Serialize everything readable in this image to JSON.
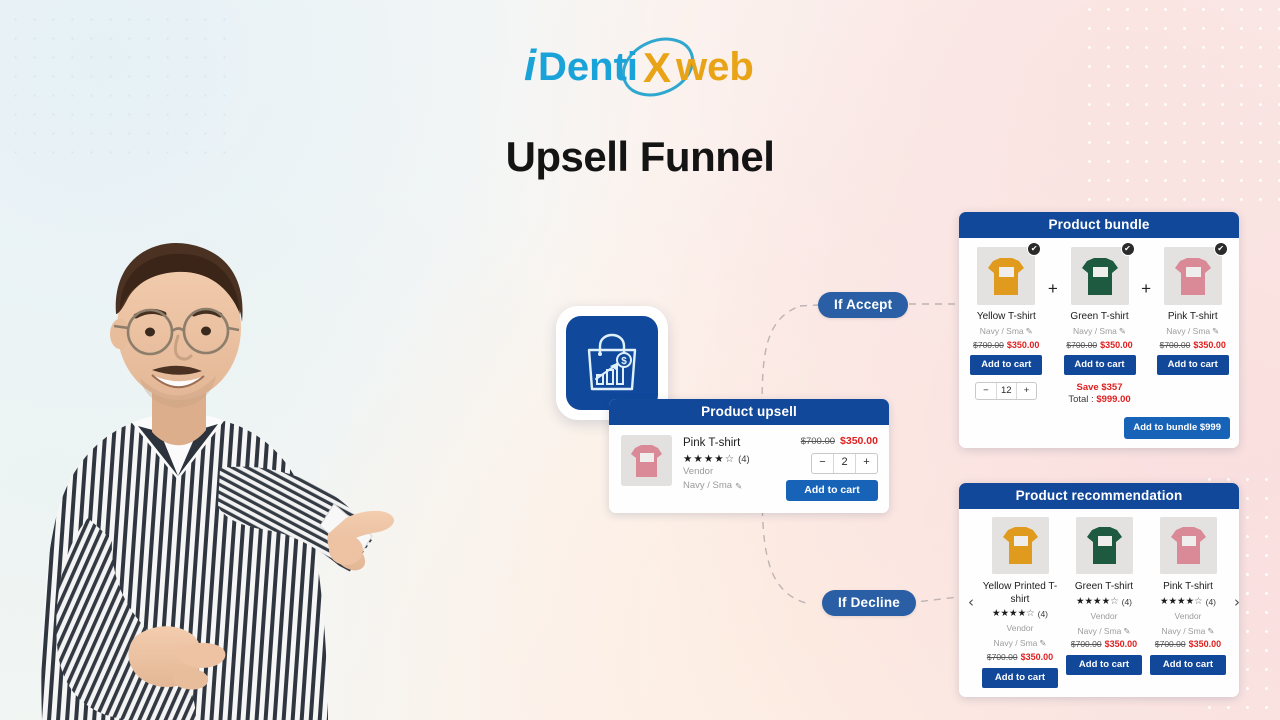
{
  "brand": {
    "logo_text_1": "i",
    "logo_text_2": "Dentix",
    "logo_text_3": "web",
    "logo_name": "identixweb-logo"
  },
  "page_title": "Upsell Funnel",
  "app_icon": {
    "name": "shopping-bag-chart-icon",
    "background_color": "#10499C"
  },
  "flow": {
    "accept_label": "If Accept",
    "decline_label": "If Decline",
    "pill_color": "#2A5FA5",
    "connector_style": "dashed"
  },
  "colors": {
    "header_blue": "#12489A",
    "button_blue": "#1763B8",
    "price_red": "#E02020",
    "muted_gray": "#9D9D9D"
  },
  "upsell_card": {
    "title": "Product upsell",
    "product": {
      "name": "Pink T-shirt",
      "stars_filled": 4,
      "stars_total": 5,
      "review_count": "(4)",
      "vendor": "Vendor",
      "variant": "Navy / Sma",
      "price_old": "$700.00",
      "price_new": "$350.00",
      "quantity": "2",
      "minus_label": "−",
      "plus_label": "+",
      "add_to_cart_label": "Add to cart",
      "thumb_color": "#D98A96"
    }
  },
  "bundle_card": {
    "title": "Product bundle",
    "plus_symbol": "+",
    "check_symbol": "✔",
    "items": [
      {
        "name": "Yellow T-shirt",
        "variant": "Navy / Sma",
        "price_old": "$700.00",
        "price_new": "$350.00",
        "add_to_cart_label": "Add to cart",
        "shirt_color": "#E09A1E",
        "checked": true
      },
      {
        "name": "Green T-shirt",
        "variant": "Navy / Sma",
        "price_old": "$700.00",
        "price_new": "$350.00",
        "add_to_cart_label": "Add to cart",
        "shirt_color": "#1D5A3F",
        "checked": true
      },
      {
        "name": "Pink T-shirt",
        "variant": "Navy / Sma",
        "price_old": "$700.00",
        "price_new": "$350.00",
        "add_to_cart_label": "Add to cart",
        "shirt_color": "#D98A96",
        "checked": true
      }
    ],
    "quantity": "12",
    "minus_label": "−",
    "plus_label": "+",
    "save_label": "Save $357",
    "total_label": "Total : ",
    "total_value": "$999.00",
    "bundle_cta_label": "Add to bundle $999"
  },
  "recommendation_card": {
    "title": "Product recommendation",
    "prev_label": "‹",
    "next_label": "›",
    "items": [
      {
        "name": "Yellow Printed T-shirt",
        "stars_filled": 4,
        "review_count": "(4)",
        "vendor": "Vendor",
        "variant": "Navy / Sma",
        "price_old": "$700.00",
        "price_new": "$350.00",
        "add_to_cart_label": "Add to cart",
        "shirt_color": "#E09A1E"
      },
      {
        "name": "Green T-shirt",
        "stars_filled": 4,
        "review_count": "(4)",
        "vendor": "Vendor",
        "variant": "Navy / Sma",
        "price_old": "$700.00",
        "price_new": "$350.00",
        "add_to_cart_label": "Add to cart",
        "shirt_color": "#1D5A3F"
      },
      {
        "name": "Pink T-shirt",
        "stars_filled": 4,
        "review_count": "(4)",
        "vendor": "Vendor",
        "variant": "Navy / Sma",
        "price_old": "$700.00",
        "price_new": "$350.00",
        "add_to_cart_label": "Add to cart",
        "shirt_color": "#D98A96"
      }
    ]
  },
  "person": {
    "description": "smiling-man-pointing"
  }
}
